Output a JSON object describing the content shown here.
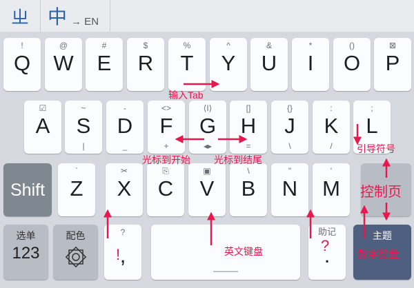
{
  "topbar": {
    "left_glyph": "ㄓ",
    "mode_char": "中",
    "switch_label": "→ EN"
  },
  "row1": [
    {
      "main": "Q",
      "sub": "!"
    },
    {
      "main": "W",
      "sub": "@"
    },
    {
      "main": "E",
      "sub": "#"
    },
    {
      "main": "R",
      "sub": "$"
    },
    {
      "main": "T",
      "sub": "%"
    },
    {
      "main": "Y",
      "sub": "^"
    },
    {
      "main": "U",
      "sub": "&"
    },
    {
      "main": "I",
      "sub": "*"
    },
    {
      "main": "O",
      "sub": "()"
    },
    {
      "main": "P",
      "sub": "⊠"
    }
  ],
  "row2": [
    {
      "main": "A",
      "sub": "☑",
      "bot": ""
    },
    {
      "main": "S",
      "sub": "~",
      "bot": "|"
    },
    {
      "main": "D",
      "sub": "-",
      "bot": "_"
    },
    {
      "main": "F",
      "sub": "<>",
      "bot": "+"
    },
    {
      "main": "G",
      "sub": "⟨I⟩",
      "bot": "◂▸"
    },
    {
      "main": "H",
      "sub": "[]",
      "bot": "="
    },
    {
      "main": "J",
      "sub": "{}",
      "bot": "\\"
    },
    {
      "main": "K",
      "sub": ":",
      "bot": "/"
    },
    {
      "main": "L",
      "sub": ";",
      "bot": ""
    }
  ],
  "row3": {
    "shift": "Shift",
    "keys": [
      {
        "main": "Z",
        "sub": "`"
      },
      {
        "main": "X",
        "sub": "✂"
      },
      {
        "main": "C",
        "sub": "⎘"
      },
      {
        "main": "V",
        "sub": "▣"
      },
      {
        "main": "B",
        "sub": "\\"
      },
      {
        "main": "N",
        "sub": "\""
      },
      {
        "main": "M",
        "sub": "'"
      }
    ],
    "control_label": "控制页"
  },
  "row4": {
    "num_top": "选单",
    "num_main": "123",
    "theme_top": "配色",
    "comma_sub": "?",
    "comma_main": ",",
    "space_bottom": "———",
    "period_sub": "助记",
    "period_main": ".",
    "right_top": "主题",
    "right_main": "数字键盘"
  },
  "annotations": {
    "tab": "输入Tab",
    "cursor_start": "光标到开始",
    "cursor_end": "光标到结尾",
    "guide": "引导符号",
    "control": "控制页",
    "english": "英文键盘",
    "bang": "!",
    "question": "?",
    "numeric": "数字键盘"
  },
  "colors": {
    "annotation": "#e8174e",
    "accent": "#2a63a6",
    "theme_key": "#4e5f80"
  }
}
